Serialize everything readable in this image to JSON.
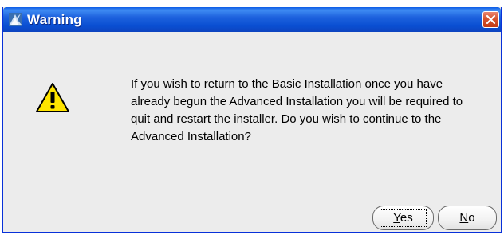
{
  "window": {
    "title": "Warning",
    "icon": "app-icon"
  },
  "titlebar": {
    "close_icon": "close-icon"
  },
  "dialog": {
    "icon": "warning-icon",
    "message": "If you wish to return to the Basic Installation once you have already begun the Advanced Installation you will be required to quit and restart the installer. Do you wish to continue to the Advanced Installation?"
  },
  "buttons": {
    "yes_label": "Yes",
    "no_label": "No"
  },
  "colors": {
    "titlebar": "#0a4fd2",
    "close_button": "#d5532f",
    "background": "#ececec",
    "warning_fill": "#ffe400"
  }
}
